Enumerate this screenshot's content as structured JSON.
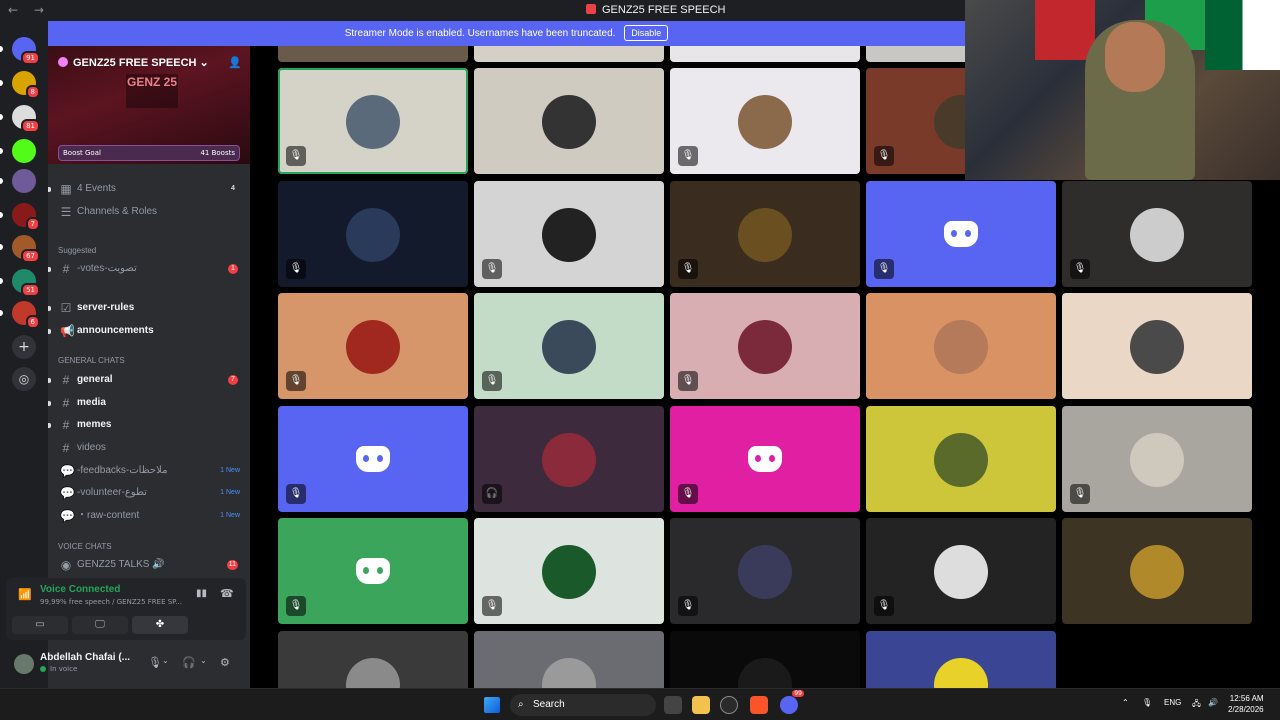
{
  "window": {
    "title": "GENZ25 FREE SPEECH",
    "nav": "← →"
  },
  "banner": {
    "text": "Streamer Mode is enabled. Usernames have been truncated.",
    "disable_label": "Disable"
  },
  "guilds": [
    {
      "name": "discord-home-icon",
      "badge": "91",
      "color": "#5865f2"
    },
    {
      "name": "server-yellow",
      "badge": "8",
      "color": "#d9a400"
    },
    {
      "name": "server-bw",
      "badge": "81",
      "color": "#dddddd"
    },
    {
      "name": "server-kick",
      "badge": "",
      "color": "#53fc18"
    },
    {
      "name": "server-avatar",
      "badge": "",
      "color": "#6f5a9a"
    },
    {
      "name": "server-red",
      "badge": "7",
      "color": "#8a1a1a"
    },
    {
      "name": "server-anime",
      "badge": "67",
      "color": "#a35a2a"
    },
    {
      "name": "server-gx",
      "badge": "51",
      "color": "#1e8a6a"
    },
    {
      "name": "server-one",
      "badge": "6",
      "color": "#c0392b"
    }
  ],
  "server": {
    "name": "GENZ25 FREE SPEECH",
    "banner_text": "GENZ 25",
    "boost_goal": "Boost Goal",
    "boost_count": "41 Boosts"
  },
  "channels": {
    "events": {
      "label": "4 Events",
      "count": "4"
    },
    "channels_roles": "Channels & Roles",
    "suggested_header": "Suggested",
    "votes": {
      "label": "-votes-تصويت",
      "count": "1"
    },
    "server_rules": "server-rules",
    "announcements": "announcements",
    "general_header": "GENERAL CHATS",
    "general": {
      "label": "general",
      "count": "7"
    },
    "media": "media",
    "memes": "memes",
    "videos": "videos",
    "feedbacks": {
      "label": "-feedbacks-ملاحظات",
      "new": "1 New"
    },
    "volunteer": {
      "label": "-volunteer-تطوع",
      "new": "1 New"
    },
    "raw_content": {
      "label": "・raw-content",
      "new": "1 New"
    },
    "voice_header": "VOICE CHATS",
    "talks": {
      "label": "GENZ25 TALKS 🔊",
      "count": "11"
    }
  },
  "voice": {
    "connected": "Voice Connected",
    "sub": "99,99% free speech / GENZ25 FREE SP..."
  },
  "user": {
    "name": "Abdellah Chafai (...",
    "status": "In voice"
  },
  "tiles": [
    {
      "color": "#d5d2c7",
      "avatar": "#5a6a7a",
      "mute": "🎙",
      "selected": true
    },
    {
      "color": "#cfcbc0",
      "avatar": "#333333",
      "mute": ""
    },
    {
      "color": "#ece9ee",
      "avatar": "#8a6a4a",
      "mute": "🎙"
    },
    {
      "color": "#7a3a2a",
      "avatar": "#4a3a2a",
      "mute": "🎙"
    },
    {
      "color": "#6b1c26",
      "avatar": "#b56a5a",
      "mute": "🎧"
    },
    {
      "color": "#121a2b",
      "avatar": "#2a3a5a",
      "mute": "🎙"
    },
    {
      "color": "#d4d4d4",
      "avatar": "#222222",
      "mute": "🎙"
    },
    {
      "color": "#3a2c1e",
      "avatar": "#6a5020",
      "mute": "🎙"
    },
    {
      "color": "#5865f2",
      "discord": true,
      "mute": "🎙"
    },
    {
      "color": "#2f2c2c",
      "avatar": "#cccccc",
      "mute": "🎙"
    },
    {
      "color": "#d7966a",
      "avatar": "#a0281e",
      "mute": "🎙"
    },
    {
      "color": "#c3dcc8",
      "avatar": "#3a4a5a",
      "mute": "🎙"
    },
    {
      "color": "#d8aeb3",
      "avatar": "#7a2a3a",
      "mute": "🎙"
    },
    {
      "color": "#d99264",
      "avatar": "#b57a5a",
      "mute": ""
    },
    {
      "color": "#ead7c6",
      "avatar": "#4a4a4a",
      "mute": ""
    },
    {
      "color": "#5865f2",
      "discord": true,
      "mute": "🎙"
    },
    {
      "color": "#3d2b3d",
      "avatar": "#8a2a3a",
      "mute": "🎧"
    },
    {
      "color": "#e01fa3",
      "discord": true,
      "mute": "🎙"
    },
    {
      "color": "#cdc63a",
      "avatar": "#5a6a2a",
      "mute": ""
    },
    {
      "color": "#a9a69f",
      "avatar": "#cfc8bd",
      "mute": "🎙"
    },
    {
      "color": "#3ba55c",
      "discord": true,
      "mute": "🎙"
    },
    {
      "color": "#dde3de",
      "avatar": "#1a5a2a",
      "mute": "🎙"
    },
    {
      "color": "#2a2a2c",
      "avatar": "#3a3a5a",
      "mute": "🎙"
    },
    {
      "color": "#232323",
      "avatar": "#dddddd",
      "mute": "🎙"
    },
    {
      "color": "#3e3423",
      "avatar": "#b08a2a",
      "mute": ""
    },
    {
      "color": "#3a3a3a",
      "avatar": "#8a8a8a",
      "mute": ""
    },
    {
      "color": "#6a6c72",
      "avatar": "#9a9a9a",
      "mute": ""
    },
    {
      "color": "#0a0a0a",
      "avatar": "#1a1a1a",
      "mute": ""
    },
    {
      "color": "#3a4694",
      "avatar": "#e8d22a",
      "mute": ""
    }
  ],
  "taskbar": {
    "search": "Search",
    "lang": "ENG",
    "time": "12:56 AM",
    "date": "2/28/2026",
    "discord_badge": "99"
  }
}
